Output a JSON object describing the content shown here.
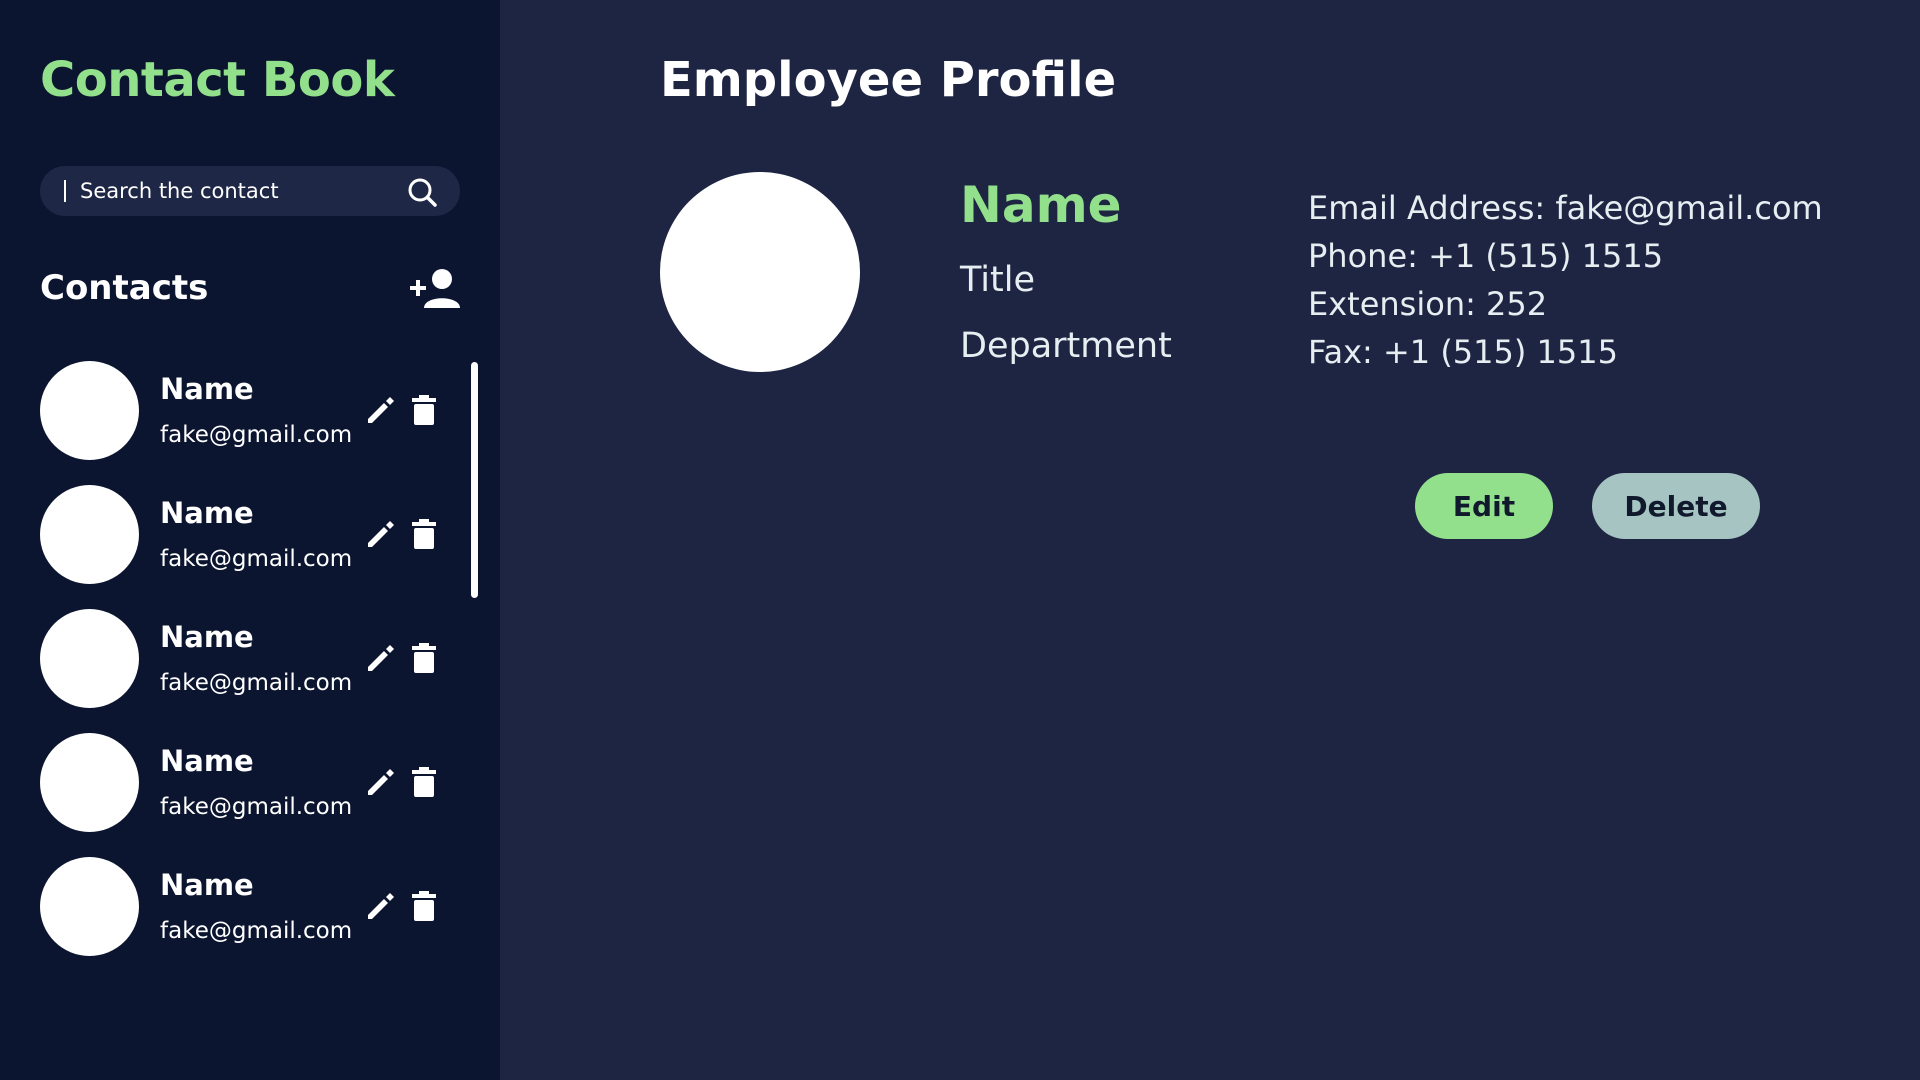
{
  "app": {
    "title": "Contact Book"
  },
  "search": {
    "placeholder": "Search the contact"
  },
  "sidebar": {
    "contacts_heading": "Contacts",
    "contacts": [
      {
        "name": "Name",
        "email": "fake@gmail.com"
      },
      {
        "name": "Name",
        "email": "fake@gmail.com"
      },
      {
        "name": "Name",
        "email": "fake@gmail.com"
      },
      {
        "name": "Name",
        "email": "fake@gmail.com"
      },
      {
        "name": "Name",
        "email": "fake@gmail.com"
      }
    ]
  },
  "profile": {
    "heading": "Employee Profile",
    "name": "Name",
    "title": "Title",
    "department": "Department",
    "email_line": "Email Address: fake@gmail.com",
    "phone_line": "Phone: +1 (515) 1515",
    "extension_line": "Extension: 252",
    "fax_line": "Fax: +1 (515) 1515",
    "edit_label": "Edit",
    "delete_label": "Delete"
  },
  "colors": {
    "accent": "#93e08c",
    "sidebar_bg": "#0c1530",
    "main_bg": "#1e2543",
    "delete_button": "#a6c4c1"
  },
  "icons": {
    "search": "search-icon",
    "add_user": "add-user-icon",
    "edit": "pencil-icon",
    "delete": "trash-icon"
  }
}
